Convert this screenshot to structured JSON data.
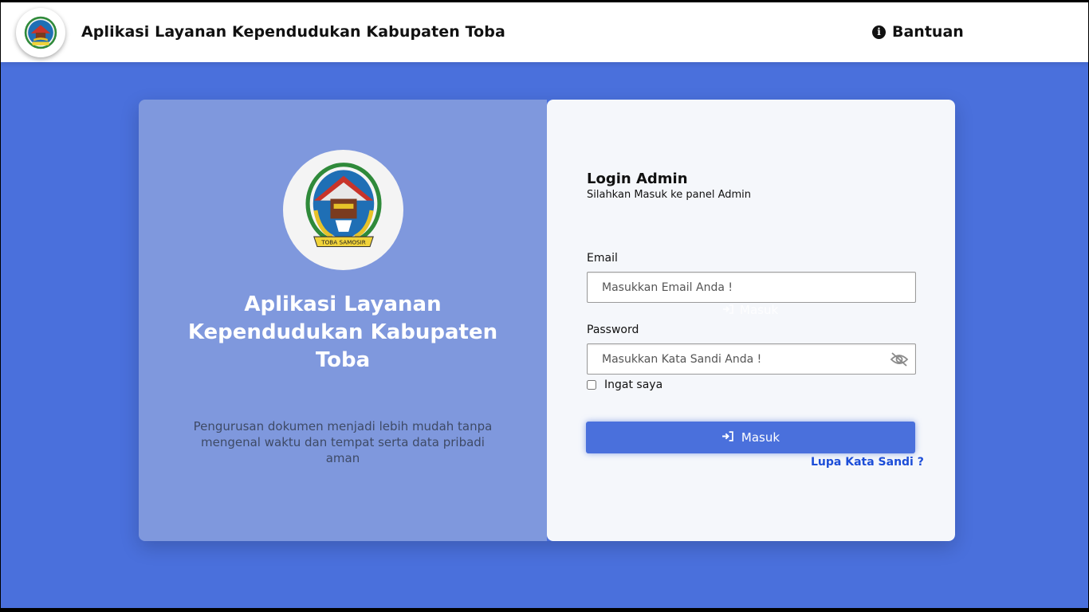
{
  "header": {
    "title": "Aplikasi Layanan Kependudukan Kabupaten Toba",
    "help_label": "Bantuan",
    "help_icon": "info-circle-icon"
  },
  "left_panel": {
    "logo_text": "TOBA SAMOSIR",
    "title": "Aplikasi Layanan Kependudukan Kabupaten Toba",
    "subtitle": "Pengurusan dokumen menjadi lebih mudah tanpa mengenal waktu dan tempat serta data pribadi aman"
  },
  "login": {
    "title": "Login Admin",
    "subtitle": "Silahkan Masuk ke panel Admin",
    "email_label": "Email",
    "email_placeholder": "Masukkan Email Anda !",
    "password_label": "Password",
    "password_placeholder": "Masukkan Kata Sandi Anda !",
    "password_toggle_icon": "eye-slash-icon",
    "remember_label": "Ingat saya",
    "ghost_label": "Masuk",
    "submit_label": "Masuk",
    "submit_icon": "sign-in-icon",
    "forgot_label": "Lupa Kata Sandi ?"
  },
  "colors": {
    "background": "#4a70dc",
    "left_panel": "#7f98dd",
    "right_panel": "#f5f7fb",
    "button": "#4a70dc",
    "link": "#1d4ed8"
  }
}
